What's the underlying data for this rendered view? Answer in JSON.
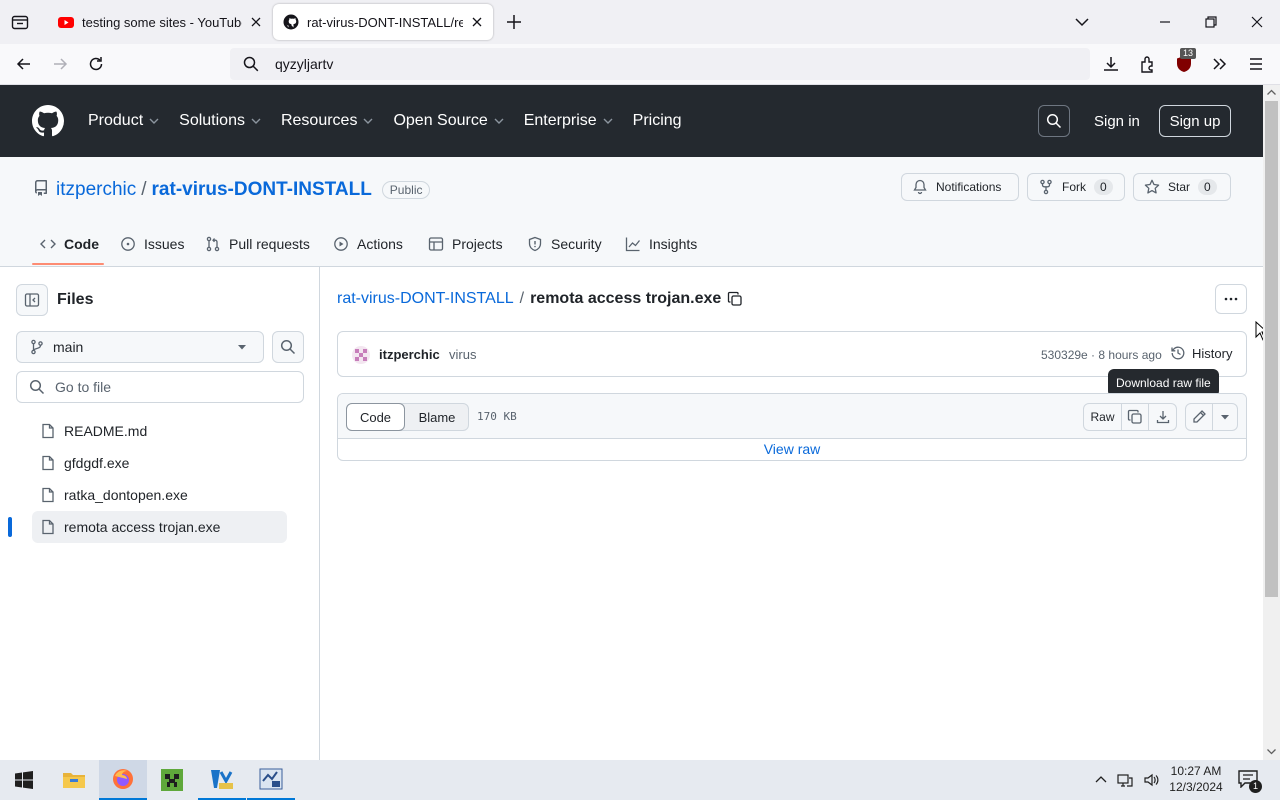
{
  "browser": {
    "tabs": [
      {
        "title": "testing some sites - YouTube"
      },
      {
        "title": "rat-virus-DONT-INSTALL/remot"
      }
    ],
    "url": "qyzyljartv",
    "extension_badge": "13"
  },
  "github": {
    "nav": [
      "Product",
      "Solutions",
      "Resources",
      "Open Source",
      "Enterprise",
      "Pricing"
    ],
    "sign_in": "Sign in",
    "sign_up": "Sign up"
  },
  "repo": {
    "owner": "itzperchic",
    "separator": "/",
    "name": "rat-virus-DONT-INSTALL",
    "visibility": "Public",
    "notifications_label": "Notifications",
    "fork_label": "Fork",
    "fork_count": "0",
    "star_label": "Star",
    "star_count": "0",
    "tabs": [
      "Code",
      "Issues",
      "Pull requests",
      "Actions",
      "Projects",
      "Security",
      "Insights"
    ]
  },
  "sidebar": {
    "title": "Files",
    "branch": "main",
    "goto_placeholder": "Go to file",
    "files": [
      "README.md",
      "gfdgdf.exe",
      "ratka_dontopen.exe",
      "remota access trojan.exe"
    ],
    "selected_index": 3
  },
  "file": {
    "breadcrumb_repo": "rat-virus-DONT-INSTALL",
    "breadcrumb_sep": "/",
    "name": "remota access trojan.exe",
    "commit_author": "itzperchic",
    "commit_message": "virus",
    "commit_meta": "530329e · 8 hours ago",
    "history_label": "History",
    "tooltip": "Download raw file",
    "view_code": "Code",
    "view_blame": "Blame",
    "size": "170 KB",
    "raw_label": "Raw",
    "view_raw": "View raw"
  },
  "taskbar": {
    "time": "10:27 AM",
    "date": "12/3/2024",
    "notification_count": "1"
  },
  "colors": {
    "github_header": "#24292f",
    "link": "#0969da",
    "accent_underline": "#fd8c73",
    "selected_bar": "#0969da"
  }
}
